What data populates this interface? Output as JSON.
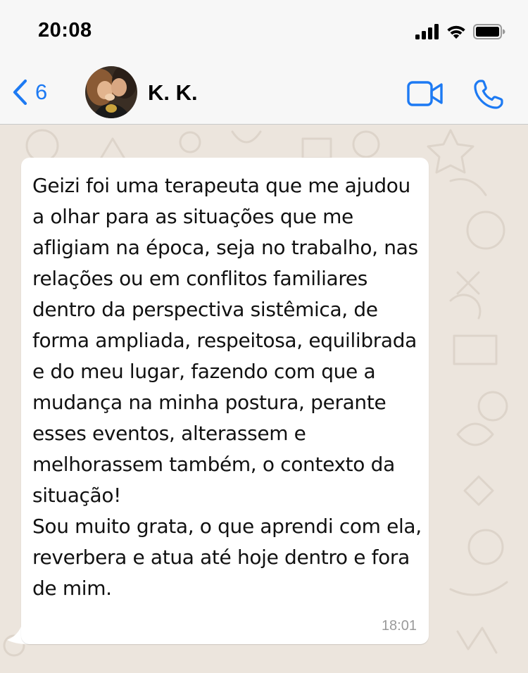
{
  "status_bar": {
    "time": "20:08",
    "icons": [
      "cellular-signal-icon",
      "wifi-icon",
      "battery-icon"
    ]
  },
  "header": {
    "back_count": "6",
    "contact_name": "K. K.",
    "icons": [
      "back-chevron-icon",
      "video-camera-icon",
      "phone-icon"
    ]
  },
  "message": {
    "text": "Geizi foi uma terapeuta que me ajudou a olhar para as situações que me afligiam na época, seja no trabalho, nas relações ou em conflitos familiares dentro da perspectiva sistêmica, de forma ampliada, respeitosa, equilibrada e do meu lugar, fazendo com que a mudança na minha postura, perante esses eventos, alterassem e melhorassem também, o contexto da situação!\nSou muito grata, o que aprendi com ela, reverbera e atua até hoje dentro e fora de mim.",
    "time": "18:01"
  },
  "colors": {
    "accent": "#1d7af3",
    "header_bg": "#f7f7f7",
    "chat_bg": "#ece5dd",
    "bubble_bg": "#ffffff",
    "timestamp": "#9a9a9a"
  }
}
